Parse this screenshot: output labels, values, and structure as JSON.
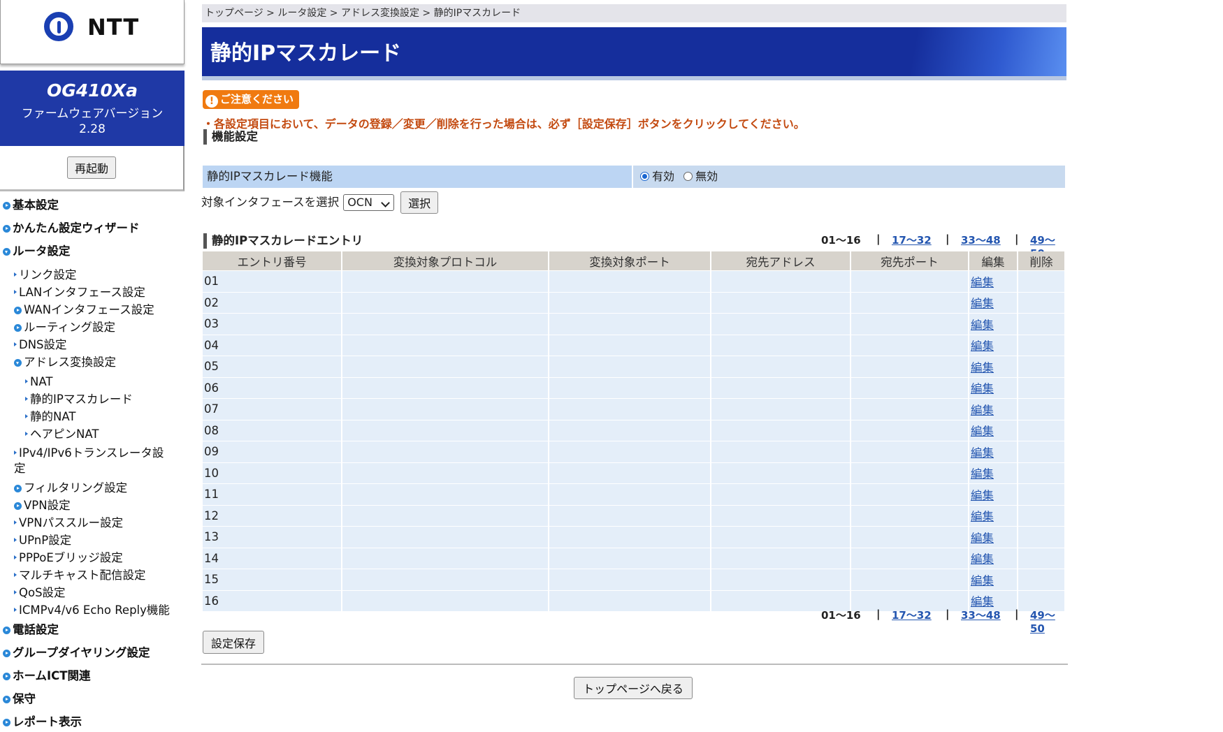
{
  "sidebar": {
    "logo_text": "NTT",
    "model_name": "OG410Xa",
    "firmware_label": "ファームウェアバージョン",
    "firmware_version": "2.28",
    "restart_label": "再起動",
    "nav": [
      {
        "label": "基本設定",
        "level": 0,
        "bullet": "circle"
      },
      {
        "label": "かんたん設定ウィザード",
        "level": 0,
        "bullet": "circle"
      },
      {
        "label": "ルータ設定",
        "level": 0,
        "bullet": "circle-open"
      },
      {
        "label": "リンク設定",
        "level": 1,
        "bullet": "tri"
      },
      {
        "label": "LANインタフェース設定",
        "level": 1,
        "bullet": "tri"
      },
      {
        "label": "WANインタフェース設定",
        "level": 1,
        "bullet": "circle"
      },
      {
        "label": "ルーティング設定",
        "level": 1,
        "bullet": "circle"
      },
      {
        "label": "DNS設定",
        "level": 1,
        "bullet": "tri"
      },
      {
        "label": "アドレス変換設定",
        "level": 1,
        "bullet": "circle-open"
      },
      {
        "label": "NAT",
        "level": 2,
        "bullet": "tri"
      },
      {
        "label": "静的IPマスカレード",
        "level": 2,
        "bullet": "tri"
      },
      {
        "label": "静的NAT",
        "level": 2,
        "bullet": "tri"
      },
      {
        "label": "ヘアピンNAT",
        "level": 2,
        "bullet": "tri"
      },
      {
        "label": "IPv4/IPv6トランスレータ設",
        "label2": "定",
        "level": 1,
        "bullet": "tri"
      },
      {
        "label": "フィルタリング設定",
        "level": 1,
        "bullet": "circle"
      },
      {
        "label": "VPN設定",
        "level": 1,
        "bullet": "circle"
      },
      {
        "label": "VPNパススルー設定",
        "level": 1,
        "bullet": "tri"
      },
      {
        "label": "UPnP設定",
        "level": 1,
        "bullet": "tri"
      },
      {
        "label": "PPPoEブリッジ設定",
        "level": 1,
        "bullet": "tri"
      },
      {
        "label": "マルチキャスト配信設定",
        "level": 1,
        "bullet": "tri"
      },
      {
        "label": "QoS設定",
        "level": 1,
        "bullet": "tri"
      },
      {
        "label": "ICMPv4/v6 Echo Reply機能",
        "level": 1,
        "bullet": "tri"
      },
      {
        "label": "電話設定",
        "level": 0,
        "bullet": "circle"
      },
      {
        "label": "グループダイヤリング設定",
        "level": 0,
        "bullet": "circle"
      },
      {
        "label": "ホームICT関連",
        "level": 0,
        "bullet": "circle"
      },
      {
        "label": "保守",
        "level": 0,
        "bullet": "circle"
      },
      {
        "label": "レポート表示",
        "level": 0,
        "bullet": "circle"
      }
    ]
  },
  "breadcrumb": "トップページ > ルータ設定 > アドレス変換設定 > 静的IPマスカレード",
  "page_title": "静的IPマスカレード",
  "caution": {
    "badge": "ご注意ください",
    "icon_glyph": "!",
    "text": "・各設定項目において、データの登録／変更／削除を行った場合は、必ず［設定保存］ボタンをクリックしてください。"
  },
  "function_section": {
    "heading": "機能設定",
    "row_label": "静的IPマスカレード機能",
    "option_enable": "有効",
    "option_disable": "無効",
    "selected": "有効"
  },
  "interface": {
    "label": "対象インタフェースを選択",
    "selected": "OCN",
    "select_button": "選択"
  },
  "entries_section": {
    "heading": "静的IPマスカレードエントリ",
    "pager": {
      "current": "01～16",
      "links": [
        "17～32",
        "33～48",
        "49～50"
      ],
      "separator": "|"
    },
    "columns": [
      "エントリ番号",
      "変換対象プロトコル",
      "変換対象ポート",
      "宛先アドレス",
      "宛先ポート",
      "編集",
      "削除"
    ],
    "edit_label": "編集",
    "rows": [
      "01",
      "02",
      "03",
      "04",
      "05",
      "06",
      "07",
      "08",
      "09",
      "10",
      "11",
      "12",
      "13",
      "14",
      "15",
      "16"
    ]
  },
  "save_button": "設定保存",
  "back_button": "トップページへ戻る",
  "colors": {
    "title_bar": "#152e9c",
    "model_box": "#1f39a6",
    "caution_badge": "#f07a10",
    "caution_text": "#c34a10",
    "link": "#2456b0",
    "row_bg": "#e4eef9",
    "header_bg": "#d7d3cc"
  }
}
